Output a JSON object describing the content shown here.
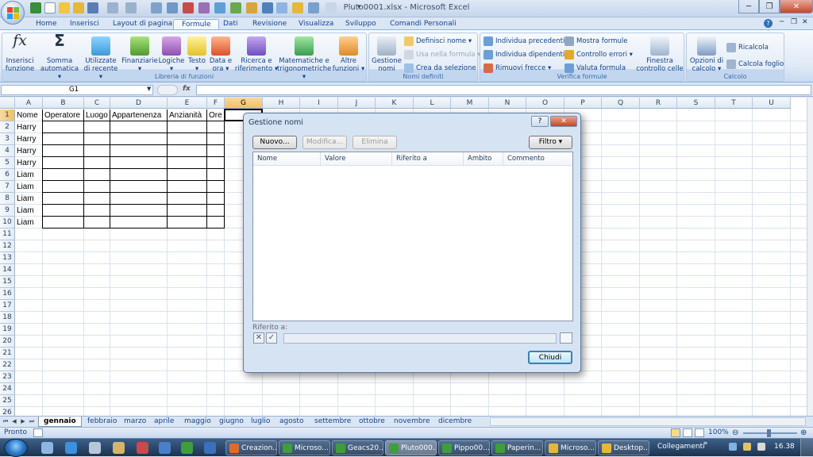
{
  "window": {
    "title": "Pluto0001.xlsx - Microsoft Excel"
  },
  "ribbon_tabs": [
    "Home",
    "Inserisci",
    "Layout di pagina",
    "Formule",
    "Dati",
    "Revisione",
    "Visualizza",
    "Sviluppo",
    "Comandi Personali"
  ],
  "active_tab": "Formule",
  "groups": {
    "libreria": {
      "title": "Libreria di funzioni",
      "buttons": {
        "inserisci": {
          "l1": "Inserisci",
          "l2": "funzione"
        },
        "somma": {
          "l1": "Somma",
          "l2": "automatica ▾"
        },
        "utilizzate": {
          "l1": "Utilizzate",
          "l2": "di recente ▾"
        },
        "finanziarie": {
          "l1": "Finanziarie",
          "l2": "▾"
        },
        "logiche": {
          "l1": "Logiche",
          "l2": "▾"
        },
        "testo": {
          "l1": "Testo",
          "l2": "▾"
        },
        "data": {
          "l1": "Data e",
          "l2": "ora ▾"
        },
        "ricerca": {
          "l1": "Ricerca e",
          "l2": "riferimento ▾"
        },
        "matematiche": {
          "l1": "Matematiche e",
          "l2": "trigonometriche ▾"
        },
        "altre": {
          "l1": "Altre",
          "l2": "funzioni ▾"
        }
      }
    },
    "nomi": {
      "title": "Nomi definiti",
      "gestione": {
        "l1": "Gestione",
        "l2": "nomi"
      },
      "definisci": "Definisci nome ▾",
      "usa": "Usa nella formula ▾",
      "crea": "Crea da selezione"
    },
    "verifica": {
      "title": "Verifica formule",
      "precedenti": "Individua precedenti",
      "dipendenti": "Individua dipendenti",
      "rimuovi": "Rimuovi frecce ▾",
      "mostra": "Mostra formule",
      "controllo": "Controllo errori ▾",
      "valuta": "Valuta formula",
      "finestra": {
        "l1": "Finestra",
        "l2": "controllo celle"
      }
    },
    "calcolo": {
      "title": "Calcolo",
      "opzioni": {
        "l1": "Opzioni di",
        "l2": "calcolo ▾"
      },
      "ricalcola": "Ricalcola",
      "calcola_foglio": "Calcola foglio"
    }
  },
  "formula_bar": {
    "name_box": "G1",
    "fx": "fx",
    "value": ""
  },
  "columns": [
    "A",
    "B",
    "C",
    "D",
    "E",
    "F",
    "G",
    "H",
    "I",
    "J",
    "K",
    "L",
    "M",
    "N",
    "O",
    "P",
    "Q",
    "R",
    "S",
    "T",
    "U"
  ],
  "selected_column": "G",
  "rows": [
    "1",
    "2",
    "3",
    "4",
    "5",
    "6",
    "7",
    "8",
    "9",
    "10",
    "11",
    "12",
    "13",
    "14",
    "15",
    "16",
    "17",
    "18",
    "19",
    "20",
    "21",
    "22",
    "23",
    "24",
    "25",
    "26"
  ],
  "headers_row": [
    "Nome",
    "Operatore",
    "Luogo",
    "Appartenenza",
    "Anzianità",
    "Ore"
  ],
  "names_col": [
    "Harry",
    "Harry",
    "Harry",
    "Harry",
    "Liam",
    "Liam",
    "Liam",
    "Liam",
    "Liam"
  ],
  "sheets": [
    "gennaio",
    "febbraio",
    "marzo",
    "aprile",
    "maggio",
    "giugno",
    "luglio",
    "agosto",
    "settembre",
    "ottobre",
    "novembre",
    "dicembre"
  ],
  "active_sheet": "gennaio",
  "status": {
    "left": "Pronto",
    "zoom": "100%"
  },
  "dialog": {
    "title": "Gestione nomi",
    "help": "?",
    "close": "✕",
    "nuovo": "Nuovo...",
    "modifica": "Modifica...",
    "elimina": "Elimina",
    "filtro": "Filtro ▾",
    "columns": [
      "Nome",
      "Valore",
      "Riferito a",
      "Ambito",
      "Commento"
    ],
    "ref_label": "Riferito a:",
    "chiudi": "Chiudi"
  },
  "taskbar": {
    "items": [
      "Creazion...",
      "Microso...",
      "Geacs20...",
      "Pluto000...",
      "Pippo00...",
      "Paperin...",
      "Microso...",
      "Desktop..."
    ],
    "active": "Pluto000...",
    "links": "Collegamenti",
    "clock": "16.38"
  },
  "colors": {
    "accent": "#15428b",
    "selected_header": "#f1c15f",
    "ribbon_bg": "#dbe6f4"
  }
}
